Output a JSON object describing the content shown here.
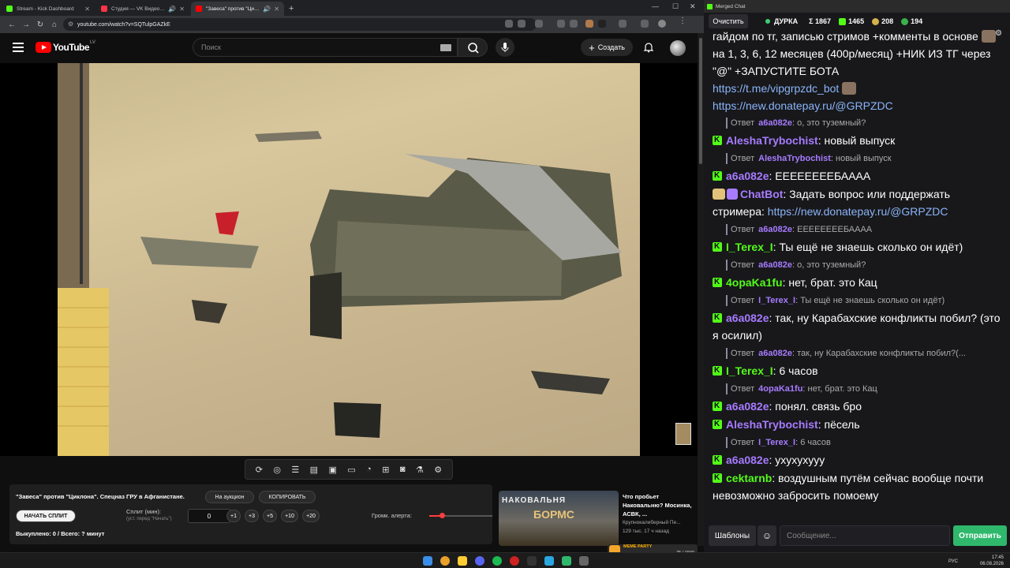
{
  "browser": {
    "tabs": [
      {
        "title": "Stream - Kick Dashboard",
        "color": "#53fc18"
      },
      {
        "title": "Студия — VK Видео Live",
        "color": "#ff3347"
      },
      {
        "title": "\"Завеса\" против \"Циклона\"",
        "color": "#ff0000"
      }
    ],
    "url": "youtube.com/watch?v=SQTulpGAZkE"
  },
  "youtube": {
    "logo_text": "YouTube",
    "region": "LV",
    "search_placeholder": "Поиск",
    "create_label": "Создать"
  },
  "stream_panel": {
    "title": "\"Завеса\" против \"Циклона\". Спецназ ГРУ в Афганистане.",
    "auction_label": "На аукцион",
    "copy_label": "КОПИРОВАТЬ",
    "start_split_label": "НАЧАТЬ СПЛИТ",
    "split_label": "Сплит (мин):",
    "split_hint": "(уст. перед \"Начать\")",
    "split_value": "0",
    "increments": [
      "+1",
      "+3",
      "+5",
      "+10",
      "+20"
    ],
    "alert_volume_label": "Громк. алерта:",
    "alert_volume": 0.2,
    "footer": "Выкуплено: 0 / Всего: ? минут"
  },
  "recommendation": {
    "thumb_text_1": "НАКОВАЛЬНЯ",
    "thumb_text_2": "БОРМС",
    "title": "Что пробьет Наковальню? Мосинка, АСВК, ...",
    "channel": "Крупнокалиберный Пе...",
    "meta": "129 тыс.   17 ч назад"
  },
  "meme_party": {
    "label": "MEME PARTY",
    "progress": "75 / 1500"
  },
  "chat": {
    "window_title": "Merged Chat",
    "clear_label": "Очистить",
    "channel": "ДУРКА",
    "stats": [
      {
        "label": "Σ 1867",
        "color": "#ffffff"
      },
      {
        "label": "1465",
        "color": "#53fc18"
      },
      {
        "label": "208",
        "color": "#d4b24a"
      },
      {
        "label": "194",
        "color": "#53fc18"
      }
    ],
    "top_text_1": "гайдом по тг, записью стримов +комменты в основе",
    "top_text_2": "на 1, 3, 6, 12 месяцев (400р/месяц)",
    "top_text_3": "+НИК ИЗ ТГ через \"@\" +ЗАПУСТИТЕ БОТА",
    "top_link_1": "https://t.me/vipgrpzdc_bot",
    "top_link_2": "https://new.donatepay.ru/@GRPZDC",
    "messages": [
      {
        "kind": "reply",
        "user": "a6a082e",
        "text": "о, это туземный?"
      },
      {
        "kind": "msg",
        "user": "AleshaTrybochist",
        "color": "#a77bff",
        "text": "новый выпуск"
      },
      {
        "kind": "reply",
        "user": "AleshaTrybochist",
        "text": "новый выпуск"
      },
      {
        "kind": "msg",
        "user": "a6a082e",
        "color": "#a77bff",
        "text": "ЕЕЕЕЕЕЕЕБАААА"
      },
      {
        "kind": "bot",
        "user": "ChatBot",
        "color": "#a77bff",
        "text": "Задать вопрос или поддержать стримера:",
        "link": "https://new.donatepay.ru/@GRPZDC"
      },
      {
        "kind": "reply",
        "user": "a6a082e",
        "text": "ЕЕЕЕЕЕЕЕБАААА"
      },
      {
        "kind": "msg",
        "user": "I_Terex_I",
        "color": "#53fc18",
        "text": "Ты ещё не знаешь сколько он идёт)"
      },
      {
        "kind": "reply",
        "user": "a6a082e",
        "text": "о, это туземный?"
      },
      {
        "kind": "msg",
        "user": "4opaKa1fu",
        "color": "#53fc18",
        "text": "нет, брат. это Кац"
      },
      {
        "kind": "reply",
        "user": "I_Terex_I",
        "text": "Ты ещё не знаешь сколько он идёт)"
      },
      {
        "kind": "msg",
        "user": "a6a082e",
        "color": "#a77bff",
        "text": "так, ну Карабахские конфликты побил? (это я осилил)"
      },
      {
        "kind": "reply",
        "user": "a6a082e",
        "text": "так, ну Карабахские конфликты побил?(..."
      },
      {
        "kind": "msg",
        "user": "I_Terex_I",
        "color": "#53fc18",
        "text": "6 часов"
      },
      {
        "kind": "reply",
        "user": "4opaKa1fu",
        "text": "нет, брат. это Кац"
      },
      {
        "kind": "msg",
        "user": "a6a082e",
        "color": "#a77bff",
        "text": "понял. связь бро"
      },
      {
        "kind": "msg",
        "user": "AleshaTrybochist",
        "color": "#a77bff",
        "text": "пёсель"
      },
      {
        "kind": "reply",
        "user": "I_Terex_I",
        "text": "6 часов"
      },
      {
        "kind": "msg",
        "user": "a6a082e",
        "color": "#a77bff",
        "text": "ухухухууу"
      },
      {
        "kind": "msg",
        "user": "cektarnb",
        "color": "#53fc18",
        "text": "воздушным путём сейчас вообще почти невозможно забросить помоему"
      }
    ],
    "reply_prefix": "Ответ",
    "templates_label": "Шаблоны",
    "message_placeholder": "Сообщение...",
    "send_label": "Отправить"
  },
  "taskbar": {
    "lang": "РУС",
    "time": "17:45",
    "date": "06.08.2026"
  }
}
